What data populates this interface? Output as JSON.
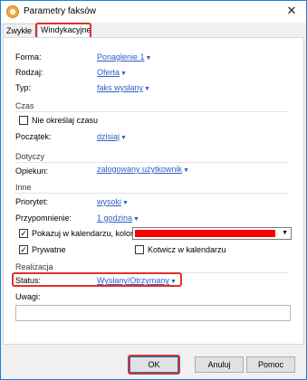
{
  "window": {
    "title": "Parametry faksów"
  },
  "tabs": [
    {
      "label": "Zwykłe"
    },
    {
      "label": "Windykacyjne"
    }
  ],
  "fields": {
    "forma": {
      "label": "Forma:",
      "value": "Ponaglenie 1"
    },
    "rodzaj": {
      "label": "Rodzaj:",
      "value": "Oferta"
    },
    "typ": {
      "label": "Typ:",
      "value": "faks wysłany"
    }
  },
  "czas": {
    "header": "Czas",
    "no_time_label": "Nie określaj czasu",
    "start_label": "Początek:",
    "start_value": "dzisiaj"
  },
  "dotyczy": {
    "header": "Dotyczy",
    "keeper_label": "Opiekun:",
    "keeper_value": "zalogowany użytkownik"
  },
  "inne": {
    "header": "Inne",
    "priority_label": "Priorytet:",
    "priority_value": "wysoki",
    "reminder_label": "Przypomnienie:",
    "reminder_value": "1 godzina",
    "show_calendar_label": "Pokazuj w kalendarzu, kolor:",
    "color": "#ff0000",
    "private_label": "Prywatne",
    "anchor_label": "Kotwicz w kalendarzu"
  },
  "realizacja": {
    "header": "Realizacja",
    "status_label": "Status:",
    "status_value": "Wysłany/Otrzymany",
    "notes_label": "Uwagi:"
  },
  "buttons": {
    "ok": "OK",
    "cancel": "Anuluj",
    "help": "Pomoc"
  }
}
